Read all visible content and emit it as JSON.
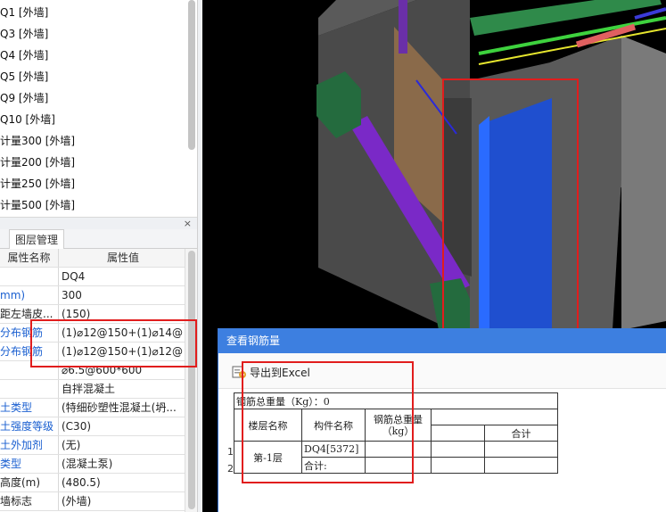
{
  "wall_list": {
    "items": [
      "Q1 [外墙]",
      "Q3 [外墙]",
      "Q4 [外墙]",
      "Q5 [外墙]",
      "Q9 [外墙]",
      "Q10 [外墙]",
      "计量300 [外墙]",
      "计量200 [外墙]",
      "计量250 [外墙]",
      "计量500 [外墙]"
    ]
  },
  "panel": {
    "close_glyph": "×",
    "tab_layer": "图层管理"
  },
  "properties": {
    "header_name": "属性名称",
    "header_value": "属性值",
    "rows": [
      {
        "name": "",
        "value": "DQ4"
      },
      {
        "name": "mm)",
        "value": "300"
      },
      {
        "name": "距左墙皮...",
        "value": "(150)"
      },
      {
        "name": "分布钢筋",
        "value": "(1)⌀12@150+(1)⌀14@"
      },
      {
        "name": "分布钢筋",
        "value": "(1)⌀12@150+(1)⌀12@"
      },
      {
        "name": "",
        "value": "⌀6.5@600*600"
      },
      {
        "name": "",
        "value": "自拌混凝土"
      },
      {
        "name": "土类型",
        "value": "(特细砂塑性混凝土(坍..."
      },
      {
        "name": "土强度等级",
        "value": "(C30)"
      },
      {
        "name": "土外加剂",
        "value": "(无)"
      },
      {
        "name": "类型",
        "value": "(混凝土泵)"
      },
      {
        "name": "高度(m)",
        "value": "(480.5)"
      },
      {
        "name": "墙标志",
        "value": "(外墙)"
      }
    ]
  },
  "dialog": {
    "title": "查看钢筋量",
    "export_label": "导出到Excel",
    "total_weight": "钢筋总重量（Kg）：0",
    "col_floor": "楼层名称",
    "col_member": "构件名称",
    "col_weight": "钢筋总重量（kg）",
    "col_total": "合计",
    "row_numbers": [
      "1",
      "2"
    ],
    "floor_name": "第-1层",
    "member_name": "DQ4[5372]",
    "subtotal_label": "合计:"
  },
  "colors": {
    "dialog_title_bg": "#3d7fe0",
    "highlight_red": "#e11d1d",
    "link_blue": "#1a5fd0"
  }
}
